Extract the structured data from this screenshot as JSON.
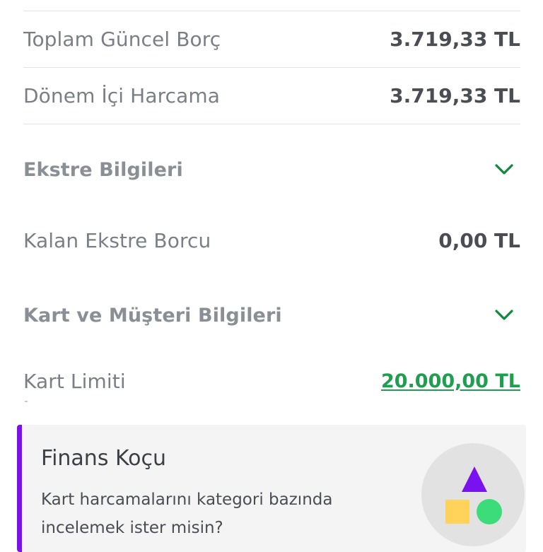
{
  "summary_rows": [
    {
      "label": "Toplam Güncel Borç",
      "value": "3.719,33 TL"
    },
    {
      "label": "Dönem İçi Harcama",
      "value": "3.719,33 TL"
    }
  ],
  "statement_section": {
    "title": "Ekstre Bilgileri",
    "icon": "chevron-down-icon",
    "rows": [
      {
        "label": "Kalan Ekstre Borcu",
        "value": "0,00 TL"
      }
    ]
  },
  "card_section": {
    "title": "Kart ve Müşteri Bilgileri",
    "icon": "chevron-down-icon",
    "rows": [
      {
        "label": "Kart Limiti",
        "value": "20.000,00 TL"
      }
    ]
  },
  "finance_coach": {
    "title": "Finans Koçu",
    "text": "Kart harcamalarını kategori bazında incelemek ister misin?",
    "illustration": "shapes-icon"
  },
  "colors": {
    "accent_green": "#1f9e4f",
    "chevron_green": "#0f8a3c",
    "coach_purple": "#7a12f0",
    "shape_yellow": "#ffd35a",
    "shape_green": "#3ddc7a"
  }
}
